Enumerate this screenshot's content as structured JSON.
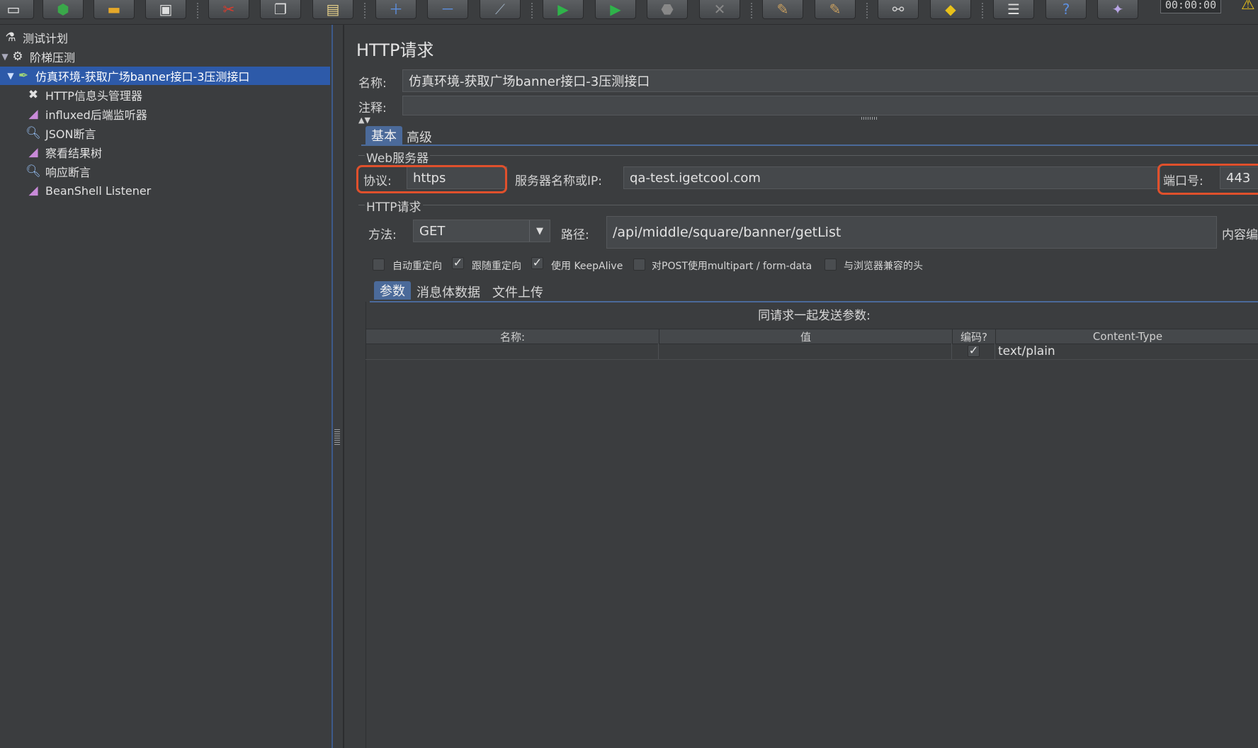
{
  "toolbar": {
    "timer": "00:00:00",
    "buttons": [
      "new-icon",
      "templates-icon",
      "open-icon",
      "save-icon",
      "cut-icon",
      "copy-icon",
      "paste-icon",
      "expand-icon",
      "collapse-icon",
      "toggle-icon",
      "start-icon",
      "start-no-pause-icon",
      "stop-icon",
      "shutdown-icon",
      "clear-icon",
      "clear-all-icon",
      "search-icon",
      "reset-search-icon",
      "function-helper-icon",
      "help-icon",
      "remote-icon"
    ]
  },
  "tree": {
    "items": [
      {
        "label": "测试计划",
        "icon": "flask-icon"
      },
      {
        "label": "阶梯压测",
        "icon": "gear-icon"
      },
      {
        "label": "仿真环境-获取广场banner接口-3压测接口",
        "icon": "pipette-icon"
      },
      {
        "label": "HTTP信息头管理器",
        "icon": "tools-icon"
      },
      {
        "label": "influxed后端监听器",
        "icon": "chart-icon"
      },
      {
        "label": "JSON断言",
        "icon": "magnifier-icon"
      },
      {
        "label": "察看结果树",
        "icon": "chart-icon"
      },
      {
        "label": "响应断言",
        "icon": "magnifier-icon"
      },
      {
        "label": "BeanShell Listener",
        "icon": "chart-icon"
      }
    ]
  },
  "panel": {
    "title": "HTTP请求",
    "name_label": "名称:",
    "name_value": "仿真环境-获取广场banner接口-3压测接口",
    "comment_label": "注释:",
    "comment_value": "",
    "tabs": [
      "基本",
      "高级"
    ],
    "web_server": {
      "group_label": "Web服务器",
      "protocol_label": "协议:",
      "protocol_value": "https",
      "server_label": "服务器名称或IP:",
      "server_value": "qa-test.igetcool.com",
      "port_label": "端口号:",
      "port_value": "443"
    },
    "http_request": {
      "group_label": "HTTP请求",
      "method_label": "方法:",
      "method_value": "GET",
      "path_label": "路径:",
      "path_value": "/api/middle/square/banner/getList",
      "encoding_label": "内容编"
    },
    "options": [
      {
        "label": "自动重定向",
        "checked": false
      },
      {
        "label": "跟随重定向",
        "checked": true
      },
      {
        "label": "使用 KeepAlive",
        "checked": true
      },
      {
        "label": "对POST使用multipart / form-data",
        "checked": false
      },
      {
        "label": "与浏览器兼容的头",
        "checked": false
      }
    ],
    "sub_tabs": [
      "参数",
      "消息体数据",
      "文件上传"
    ],
    "params_title": "同请求一起发送参数:",
    "columns": [
      "名称:",
      "值",
      "编码?",
      "Content-Type"
    ],
    "rows": [
      {
        "name": "",
        "value": "",
        "encode": true,
        "content_type": "text/plain"
      }
    ]
  },
  "colors": {
    "selection": "#2d5aa9",
    "highlight_box": "#e0502c",
    "background": "#3b3d3f"
  }
}
